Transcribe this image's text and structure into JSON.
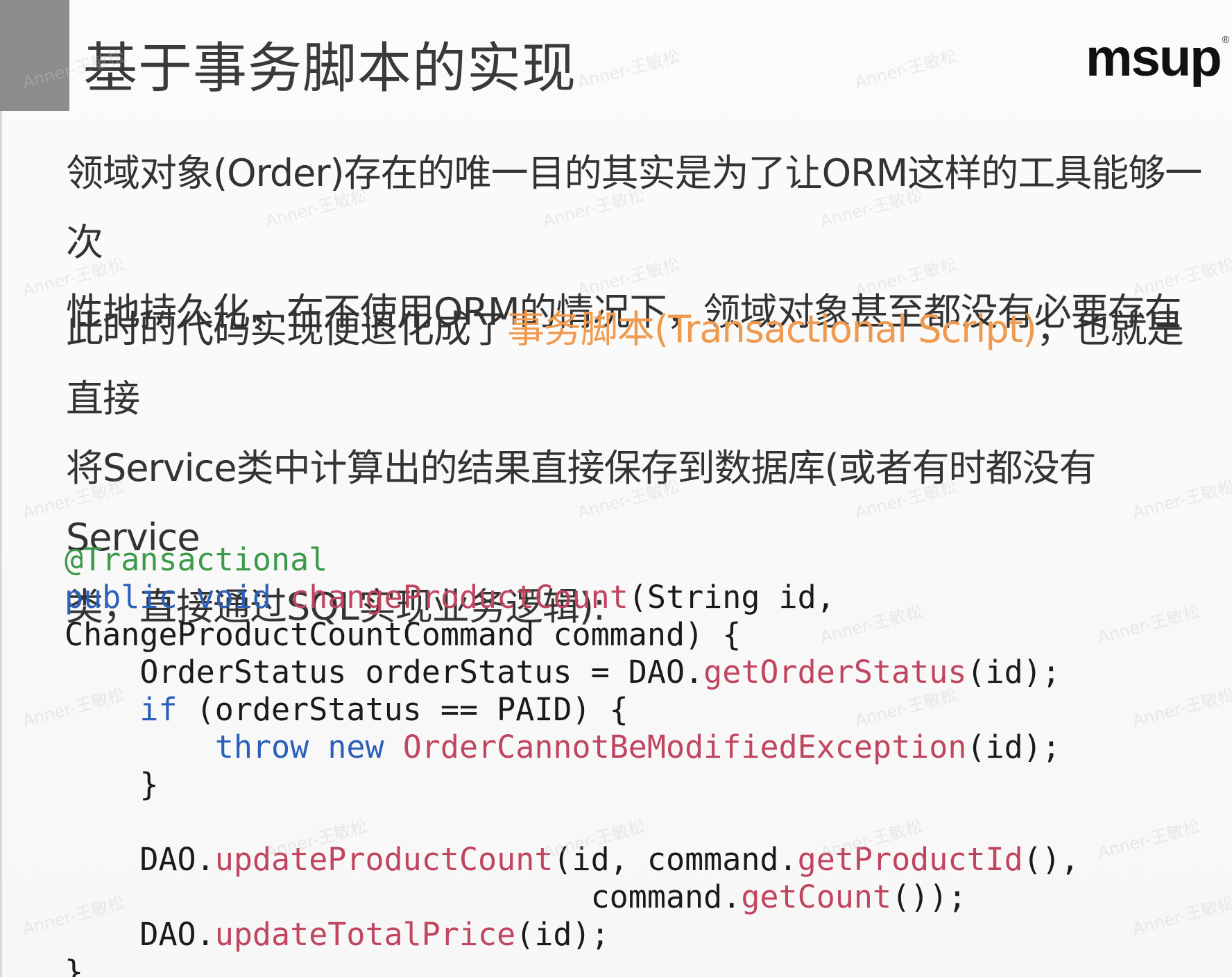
{
  "slide": {
    "title": "基于事务脚本的实现",
    "logo": "msup",
    "logo_mark": "®"
  },
  "paragraph1": {
    "line1": "领域对象(Order)存在的唯一目的其实是为了让ORM这样的工具能够一次",
    "line2": "性地持久化，在不使用ORM的情况下，领域对象甚至都没有必要存在"
  },
  "paragraph2": {
    "prefix": "此时的代码实现便退化成了",
    "highlight": "事务脚本(Transactional Script)",
    "suffix": "，也就是直接",
    "line2": "将Service类中计算出的结果直接保存到数据库(或者有时都没有Service",
    "line3": "类，直接通过SQL实现业务逻辑):"
  },
  "code": {
    "annotation": "@Transactional",
    "kw_public": "public",
    "kw_void": "void",
    "fn_name": "changeProductCount",
    "sig_rest": "(String id,",
    "line3": "ChangeProductCountCommand command) {",
    "l4_a": "    OrderStatus orderStatus = DAO.",
    "l4_fn": "getOrderStatus",
    "l4_b": "(id);",
    "l5_indent": "    ",
    "l5_kw": "if",
    "l5_rest": " (orderStatus == PAID) {",
    "l6_indent": "        ",
    "l6_kw1": "throw",
    "l6_kw2": "new",
    "l6_fn": "OrderCannotBeModifiedException",
    "l6_rest": "(id);",
    "l7": "    }",
    "l9_a": "    DAO.",
    "l9_fn1": "updateProductCount",
    "l9_b": "(id, command.",
    "l9_fn2": "getProductId",
    "l9_c": "(),",
    "l10_a": "                            command.",
    "l10_fn": "getCount",
    "l10_b": "());",
    "l11_a": "    DAO.",
    "l11_fn": "updateTotalPrice",
    "l11_b": "(id);",
    "l12": "}"
  },
  "watermark_text": "Anner-王敏松",
  "colors": {
    "title_bar": "#8c8c8c",
    "highlight": "#ef9a4e",
    "annotation": "#3d9a4a",
    "keyword": "#2c5fb8",
    "function": "#c0455e"
  }
}
